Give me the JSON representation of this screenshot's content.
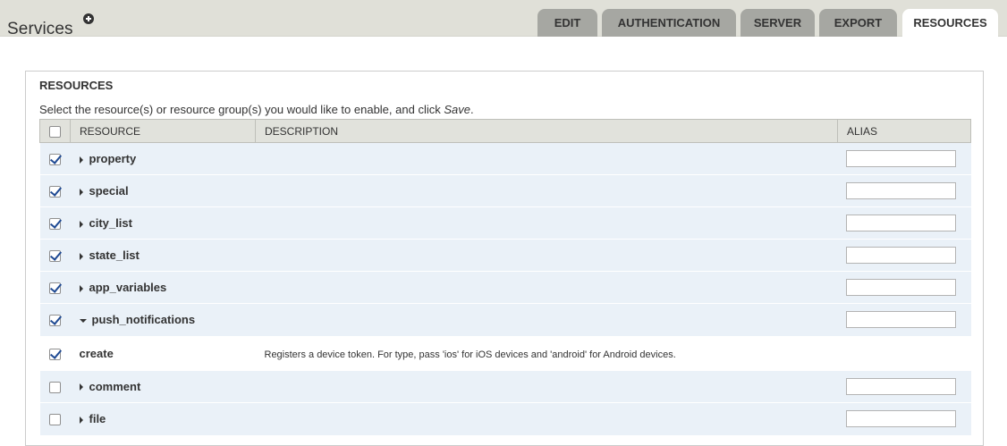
{
  "header": {
    "title": "Services",
    "tabs": [
      {
        "label": "EDIT",
        "active": false
      },
      {
        "label": "AUTHENTICATION",
        "active": false
      },
      {
        "label": "SERVER",
        "active": false
      },
      {
        "label": "EXPORT",
        "active": false
      },
      {
        "label": "RESOURCES",
        "active": true
      }
    ]
  },
  "fieldset": {
    "legend": "RESOURCES",
    "help_prefix": "Select the resource(s) or resource group(s) you would like to enable, and click ",
    "help_emphasis": "Save",
    "help_suffix": "."
  },
  "table": {
    "headers": {
      "resource": "RESOURCE",
      "description": "DESCRIPTION",
      "alias": "ALIAS"
    },
    "rows": [
      {
        "type": "group",
        "name": "property",
        "checked": true,
        "expanded": false,
        "alias": ""
      },
      {
        "type": "group",
        "name": "special",
        "checked": true,
        "expanded": false,
        "alias": ""
      },
      {
        "type": "group",
        "name": "city_list",
        "checked": true,
        "expanded": false,
        "alias": ""
      },
      {
        "type": "group",
        "name": "state_list",
        "checked": true,
        "expanded": false,
        "alias": ""
      },
      {
        "type": "group",
        "name": "app_variables",
        "checked": true,
        "expanded": false,
        "alias": ""
      },
      {
        "type": "group",
        "name": "push_notifications",
        "checked": true,
        "expanded": true,
        "alias": ""
      },
      {
        "type": "child",
        "name": "create",
        "checked": true,
        "description": "Registers a device token. For type, pass 'ios' for iOS devices and 'android' for Android devices."
      },
      {
        "type": "group",
        "name": "comment",
        "checked": false,
        "expanded": false,
        "alias": ""
      },
      {
        "type": "group",
        "name": "file",
        "checked": false,
        "expanded": false,
        "alias": ""
      }
    ]
  },
  "colors": {
    "topbar": "#e0e0d8",
    "tab": "#a6a7a2",
    "row_group": "#eaf1f8",
    "header": "#e1e2dc",
    "check": "#1f4a93"
  },
  "icons": {
    "add": "plus-circle-icon",
    "collapsed": "triangle-right-icon",
    "expanded": "triangle-down-icon"
  }
}
